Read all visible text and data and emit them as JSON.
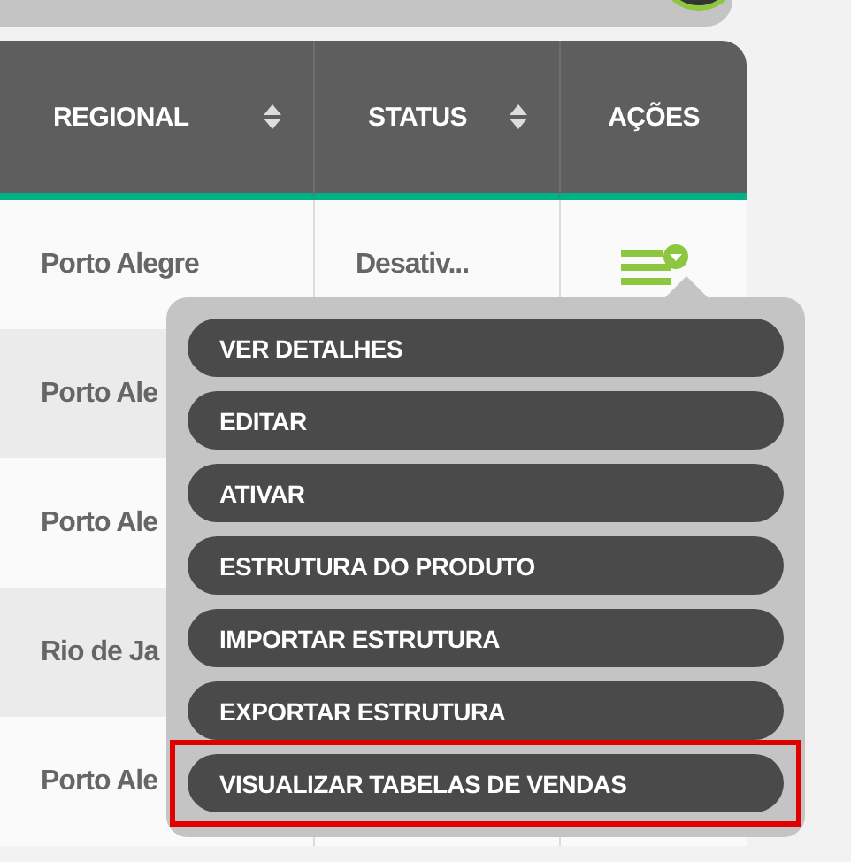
{
  "table": {
    "columns": [
      {
        "label": "REGIONAL",
        "sortable": true
      },
      {
        "label": "STATUS",
        "sortable": true
      },
      {
        "label": "AÇÕES",
        "sortable": false
      }
    ],
    "rows": [
      {
        "regional": "Porto Alegre",
        "status": "Desativ...",
        "actions": true
      },
      {
        "regional": "Porto Ale"
      },
      {
        "regional": "Porto Ale"
      },
      {
        "regional": "Rio de Ja"
      },
      {
        "regional": "Porto Ale"
      }
    ]
  },
  "menu": {
    "items": [
      {
        "label": "VER DETALHES",
        "highlighted": false
      },
      {
        "label": "EDITAR",
        "highlighted": false
      },
      {
        "label": "ATIVAR",
        "highlighted": false
      },
      {
        "label": "ESTRUTURA DO PRODUTO",
        "highlighted": false
      },
      {
        "label": "IMPORTAR ESTRUTURA",
        "highlighted": false
      },
      {
        "label": "EXPORTAR ESTRUTURA",
        "highlighted": false
      },
      {
        "label": "VISUALIZAR TABELAS DE VENDAS",
        "highlighted": true
      }
    ]
  }
}
